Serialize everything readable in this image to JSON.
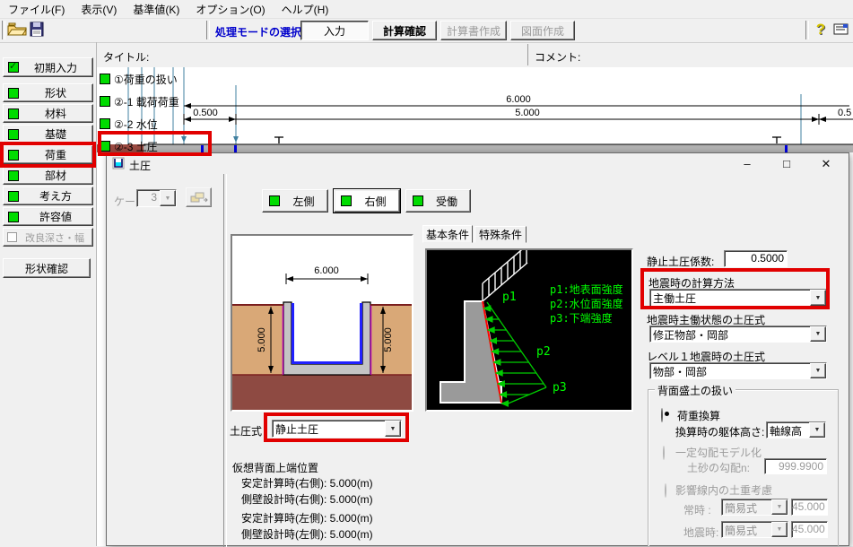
{
  "menu": {
    "items": [
      "ファイル(F)",
      "表示(V)",
      "基準値(K)",
      "オプション(O)",
      "ヘルプ(H)"
    ]
  },
  "toolbar": {
    "mode_label": "処理モードの選択",
    "input": "入力",
    "calc_check": "計算確認",
    "report": "計算書作成",
    "drawing": "図面作成"
  },
  "sidebar": {
    "initial": "初期入力",
    "shape": "形状",
    "material": "材料",
    "foundation": "基礎",
    "load": "荷重",
    "member": "部材",
    "approach": "考え方",
    "allowable": "許容値",
    "improve": "改良深さ・幅",
    "shape_confirm": "形状確認"
  },
  "workspace": {
    "title_label": "タイトル:",
    "comment_label": "コメント:",
    "nav": [
      "①荷重の扱い",
      "②-1 載荷荷重",
      "②-2 水位",
      "②-3 土圧"
    ],
    "dims": {
      "width_total": "6.000",
      "left_offset": "0.500",
      "width_inner": "5.000",
      "right_offset": "0.5"
    }
  },
  "dialog": {
    "title": "土圧",
    "minimize": "–",
    "maximize": "□",
    "close": "✕",
    "case_label": "ケース数:",
    "case_value": "3",
    "buttons": {
      "left": "左側",
      "right": "右側",
      "passive": "受働"
    },
    "tabs": {
      "basic": "基本条件",
      "special": "特殊条件"
    },
    "section": {
      "dim_width": "6.000",
      "dim_height_left": "5.000",
      "dim_height_right": "5.000"
    },
    "diagram": {
      "p1": "p1",
      "p2": "p2",
      "p3": "p3",
      "legend1": "p1:地表面強度",
      "legend2": "p2:水位面強度",
      "legend3": "p3:下端強度"
    },
    "pressure_formula": {
      "label": "土圧式",
      "value": "静止土圧"
    },
    "virtual_back": {
      "heading": "仮想背面上端位置",
      "line1": "安定計算時(右側): 5.000(m)",
      "line2": "側壁設計時(右側): 5.000(m)",
      "line3": "安定計算時(左側): 5.000(m)",
      "line4": "側壁設計時(左側): 5.000(m)"
    },
    "k0": {
      "label": "静止土圧係数:",
      "value": "0.5000"
    },
    "seismic_method": {
      "label": "地震時の計算方法",
      "value": "主働土圧"
    },
    "seismic_active": {
      "label": "地震時主働状態の土圧式",
      "value": "修正物部・岡部"
    },
    "level1": {
      "label": "レベル１地震時の土圧式",
      "value": "物部・岡部"
    },
    "backfill": {
      "label": "背面盛土の扱い",
      "opt1": "荷重換算",
      "height_label": "換算時の躯体高さ:",
      "height_value": "軸線高",
      "opt2": "一定勾配モデル化",
      "slope_label": "土砂の勾配n:",
      "slope_value": "999.9900",
      "opt3": "影響線内の土重考慮",
      "normal_label": "常時  :",
      "normal_select": "簡易式",
      "normal_value": "45.000",
      "seismic_label": "地震時:",
      "seismic_select": "簡易式",
      "seismic_value": "45.000"
    }
  },
  "colors": {
    "accent_green": "#00dc00",
    "highlight_red": "#e10000",
    "diagram_green": "#00ff00",
    "mode_label_blue": "#0000cc"
  }
}
